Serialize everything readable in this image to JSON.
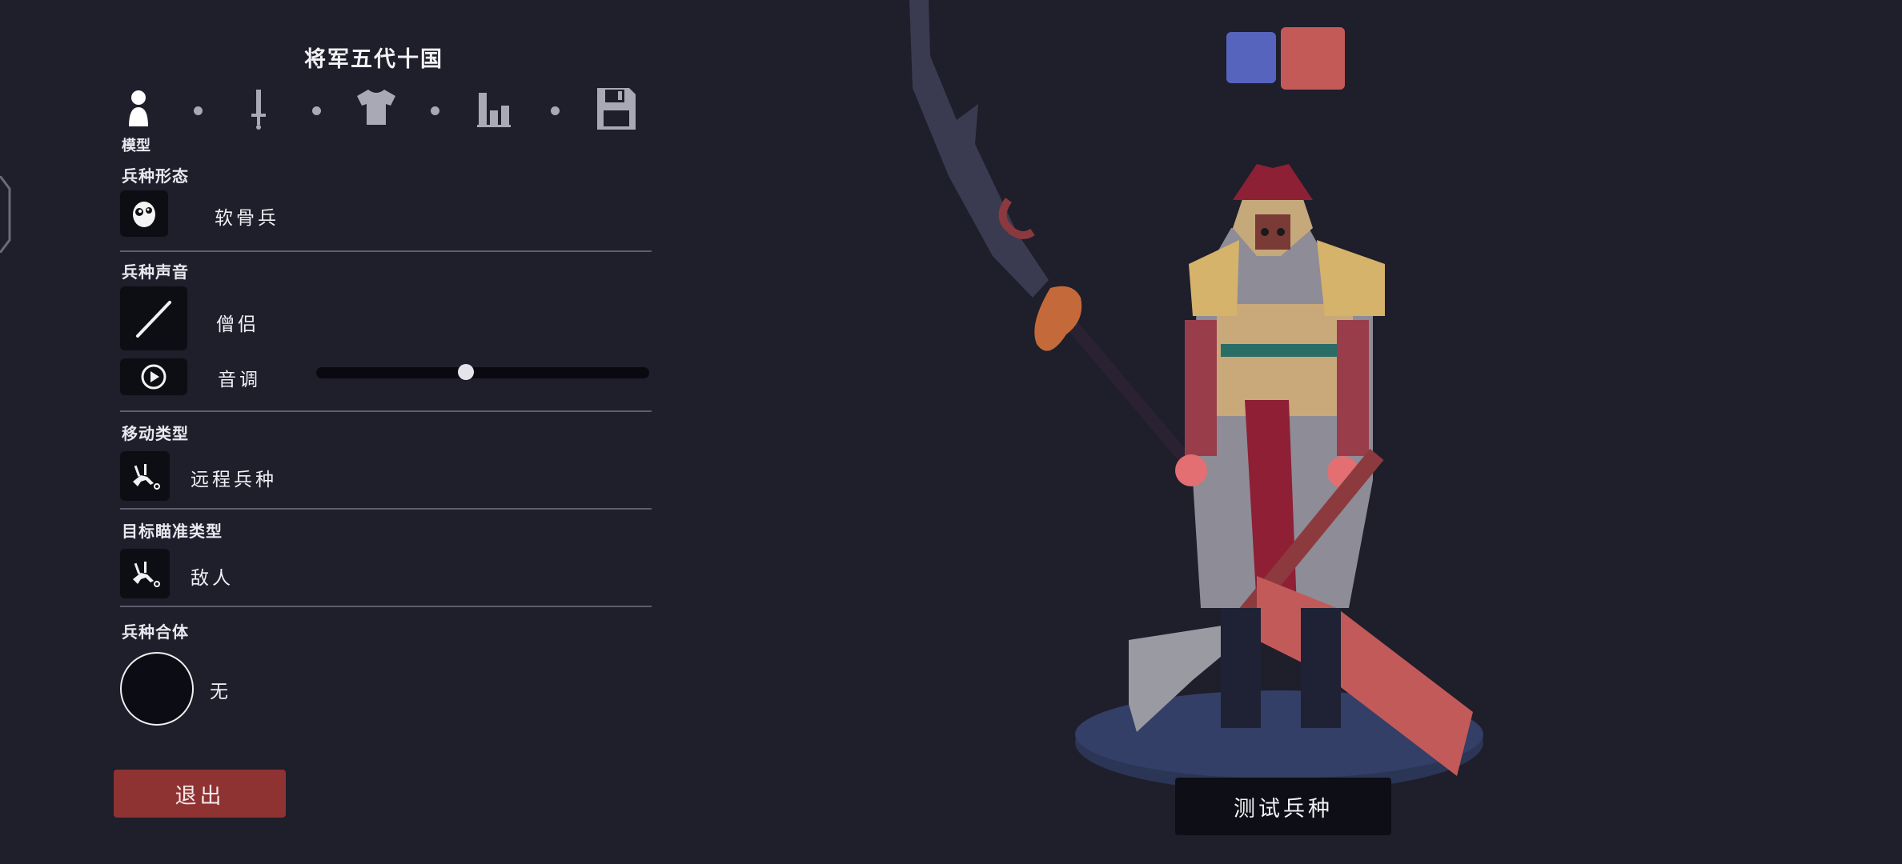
{
  "header": {
    "title": "将军五代十国"
  },
  "tabs": {
    "active_label": "模型",
    "items": [
      {
        "icon": "person-icon"
      },
      {
        "icon": "sword-icon"
      },
      {
        "icon": "shirt-icon"
      },
      {
        "icon": "stats-bars-icon"
      },
      {
        "icon": "save-floppy-icon"
      }
    ]
  },
  "sections": {
    "form": {
      "title": "兵种形态",
      "icon": "ragdoll-face-icon",
      "value": "软骨兵"
    },
    "voice": {
      "title": "兵种声音",
      "icon": "slash-icon",
      "value": "僧侣",
      "play_icon": "play-circle-icon",
      "pitch_label": "音调",
      "pitch_level": 0.45
    },
    "movement": {
      "title": "移动类型",
      "icon": "ranged-unit-icon",
      "value": "远程兵种"
    },
    "targeting": {
      "title": "目标瞄准类型",
      "icon": "target-enemy-icon",
      "value": "敌人"
    },
    "merge": {
      "title": "兵种合体",
      "value": "无"
    }
  },
  "buttons": {
    "exit": "退出",
    "test": "测试兵种"
  },
  "team_colors": {
    "blue": "#5664bd",
    "red": "#c45a58"
  },
  "colors": {
    "background": "#1f1e2b",
    "tile": "#0d0d14",
    "exit_button": "#8e3232",
    "divider": "#5d5d6b"
  }
}
